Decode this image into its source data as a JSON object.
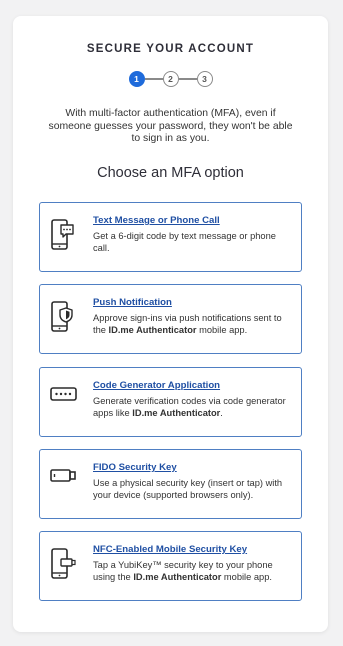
{
  "header": {
    "title": "SECURE YOUR ACCOUNT",
    "steps": [
      "1",
      "2",
      "3"
    ],
    "active_step": 1
  },
  "intro_text": "With multi-factor authentication (MFA), even if someone guesses your password, they won't be able to sign in as you.",
  "subtitle": "Choose an MFA option",
  "options": [
    {
      "title": "Text Message or Phone Call",
      "desc_before": "Get a 6-digit code by text message or phone call.",
      "desc_bold": "",
      "desc_after": "",
      "icon": "phone-message-icon"
    },
    {
      "title": "Push Notification",
      "desc_before": "Approve sign-ins via push notifications sent to the ",
      "desc_bold": "ID.me Authenticator",
      "desc_after": " mobile app.",
      "icon": "phone-shield-icon"
    },
    {
      "title": "Code Generator Application",
      "desc_before": "Generate verification codes via code generator apps like ",
      "desc_bold": "ID.me Authenticator",
      "desc_after": ".",
      "icon": "code-generator-icon"
    },
    {
      "title": "FIDO Security Key",
      "desc_before": "Use a physical security key (insert or tap) with your device (supported browsers only).",
      "desc_bold": "",
      "desc_after": "",
      "icon": "security-key-icon"
    },
    {
      "title": "NFC-Enabled Mobile Security Key",
      "desc_before": "Tap a YubiKey™ security key to your phone using the ",
      "desc_bold": "ID.me Authenticator",
      "desc_after": " mobile app.",
      "icon": "nfc-key-icon"
    }
  ],
  "colors": {
    "accent": "#1f6bdb",
    "link": "#1f4fa3",
    "border": "#4f7fc3"
  }
}
